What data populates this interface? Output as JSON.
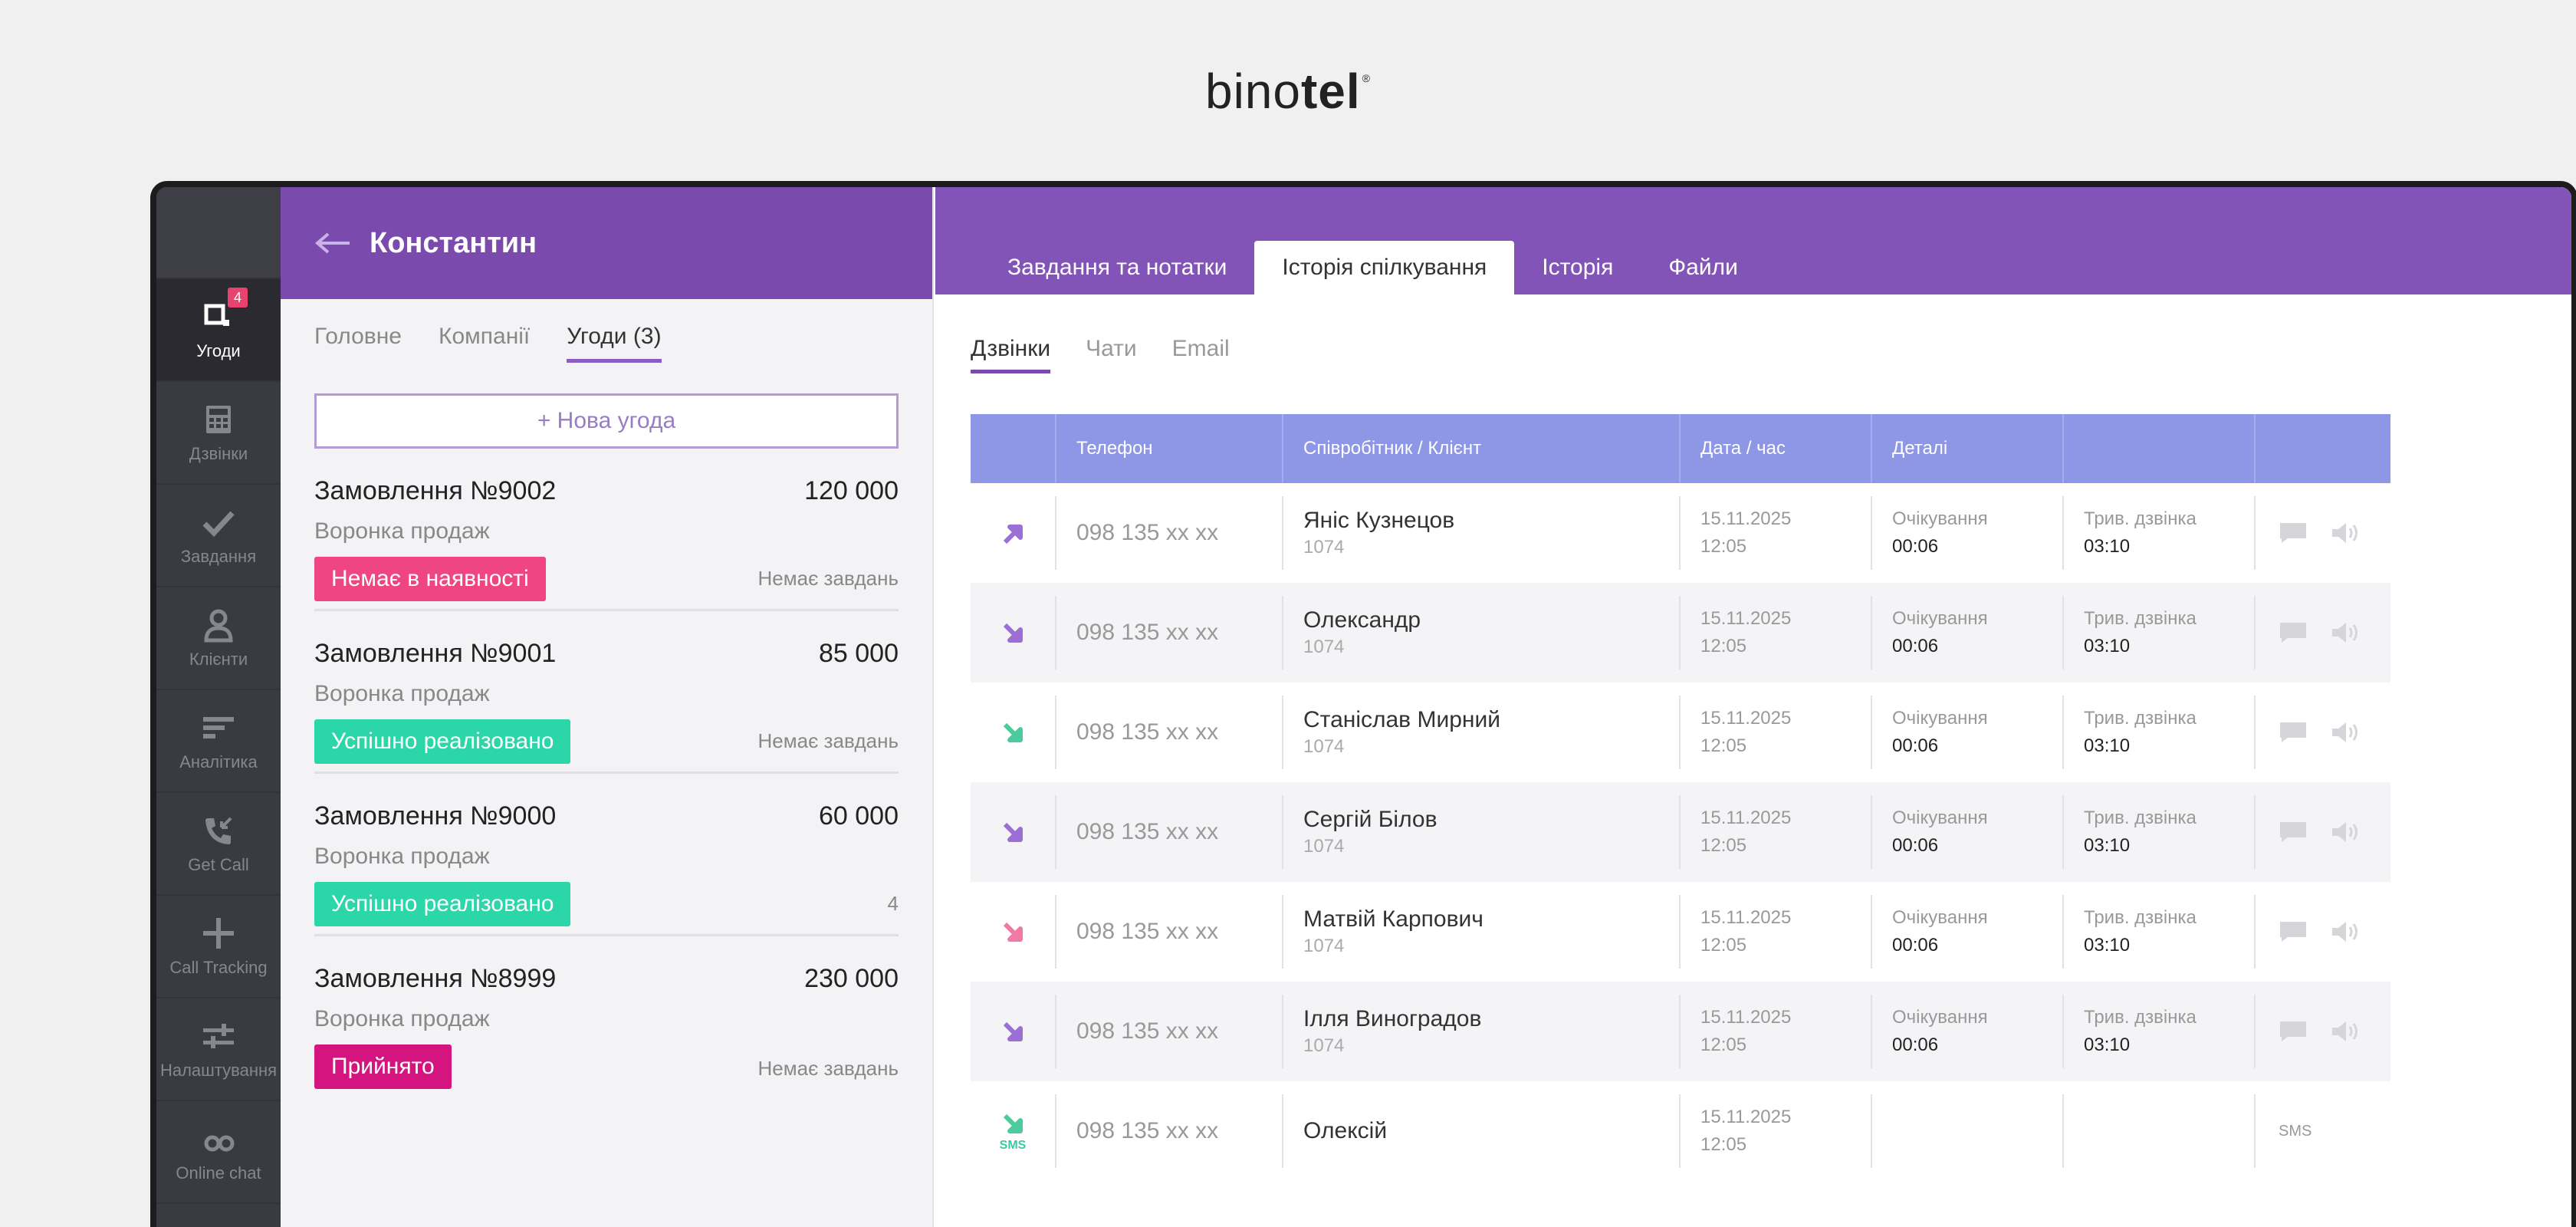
{
  "brand": {
    "light": "bino",
    "bold": "tel",
    "mark": "®"
  },
  "nav": {
    "items": [
      {
        "label": "Угоди",
        "icon": "deals-icon",
        "badge": "4",
        "active": true
      },
      {
        "label": "Дзвінки",
        "icon": "calls-icon"
      },
      {
        "label": "Завдання",
        "icon": "check-icon"
      },
      {
        "label": "Клієнти",
        "icon": "user-icon"
      },
      {
        "label": "Аналітика",
        "icon": "analytics-icon"
      },
      {
        "label": "Get Call",
        "icon": "get-call-icon"
      },
      {
        "label": "Call Tracking",
        "icon": "call-tracking-icon"
      },
      {
        "label": "Налаштування",
        "icon": "settings-icon"
      },
      {
        "label": "Online chat",
        "icon": "chat-icon"
      }
    ]
  },
  "contact": {
    "name": "Константин",
    "tabs": [
      "Головне",
      "Компанії",
      "Угоди (3)"
    ],
    "new_deal": "+  Нова угода"
  },
  "deals": [
    {
      "title": "Замовлення №9002",
      "amount": "120 000",
      "funnel": "Воронка продаж",
      "status": "Немає в наявності",
      "status_color": "#ef4581",
      "tasks": "Немає завдань"
    },
    {
      "title": "Замовлення №9001",
      "amount": "85 000",
      "funnel": "Воронка продаж",
      "status": "Успішно реалізовано",
      "status_color": "#2bd6a8",
      "tasks": "Немає завдань"
    },
    {
      "title": "Замовлення №9000",
      "amount": "60 000",
      "funnel": "Воронка продаж",
      "status": "Успішно реалізовано",
      "status_color": "#2bd6a8",
      "tasks": "4"
    },
    {
      "title": "Замовлення №8999",
      "amount": "230 000",
      "funnel": "Воронка продаж",
      "status": "Прийнято",
      "status_color": "#d4157f",
      "tasks": "Немає завдань"
    }
  ],
  "right_tabs": [
    "Завдання та нотатки",
    "Історія спілкування",
    "Історія",
    "Файли"
  ],
  "sub_tabs": [
    "Дзвінки",
    "Чати",
    "Email"
  ],
  "table": {
    "headers": [
      "Телефон",
      "Співробітник / Клієнт",
      "Дата / час",
      "Деталі"
    ],
    "wait_label": "Очікування",
    "duration_label": "Трив. дзвінка",
    "sms_label": "SMS",
    "rows": [
      {
        "dir": "outgoing",
        "color": "#9b6fd6",
        "phone": "098 135 xx xx",
        "name": "Яніс Кузнецов",
        "ext": "1074",
        "date": "15.11.2025",
        "time": "12:05",
        "wait": "00:06",
        "dur": "03:10"
      },
      {
        "dir": "incoming",
        "color": "#9b6fd6",
        "phone": "098 135 xx xx",
        "name": "Олександр",
        "ext": "1074",
        "date": "15.11.2025",
        "time": "12:05",
        "wait": "00:06",
        "dur": "03:10"
      },
      {
        "dir": "incoming",
        "color": "#4ccc9c",
        "phone": "098 135 xx xx",
        "name": "Станіслав Мирний",
        "ext": "1074",
        "date": "15.11.2025",
        "time": "12:05",
        "wait": "00:06",
        "dur": "03:10"
      },
      {
        "dir": "incoming",
        "color": "#9b6fd6",
        "phone": "098 135 xx xx",
        "name": "Сергій Білов",
        "ext": "1074",
        "date": "15.11.2025",
        "time": "12:05",
        "wait": "00:06",
        "dur": "03:10"
      },
      {
        "dir": "incoming",
        "color": "#f07aa6",
        "phone": "098 135 xx xx",
        "name": "Матвій Карпович",
        "ext": "1074",
        "date": "15.11.2025",
        "time": "12:05",
        "wait": "00:06",
        "dur": "03:10"
      },
      {
        "dir": "incoming",
        "color": "#9b6fd6",
        "phone": "098 135 xx xx",
        "name": "Ілля Виноградов",
        "ext": "1074",
        "date": "15.11.2025",
        "time": "12:05",
        "wait": "00:06",
        "dur": "03:10"
      },
      {
        "dir": "sms",
        "color": "#4ccc9c",
        "phone": "098 135 xx xx",
        "name": "Олексій",
        "ext": "",
        "date": "15.11.2025",
        "time": "12:05",
        "wait": "",
        "dur": ""
      }
    ]
  }
}
